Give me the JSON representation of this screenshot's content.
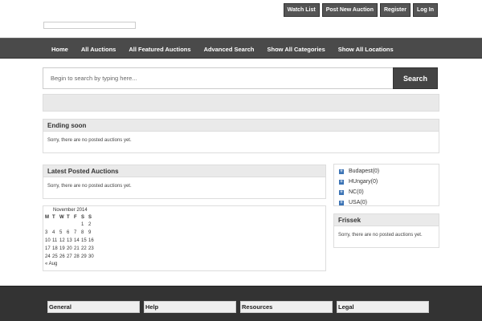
{
  "header": {
    "actions": [
      "Watch List",
      "Post New Auction",
      "Register",
      "Log In"
    ]
  },
  "nav": {
    "items": [
      "Home",
      "All Auctions",
      "All Featured Auctions",
      "Advanced Search",
      "Show All Categories",
      "Show All Locations"
    ]
  },
  "search": {
    "placeholder": "Begin to search by typing here...",
    "button_label": "Search"
  },
  "ending_soon": {
    "title": "Ending soon",
    "message": "Sorry, there are no posted auctions yet."
  },
  "latest": {
    "title": "Latest Posted Auctions",
    "message": "Sorry, there are no posted auctions yet."
  },
  "locations": {
    "items": [
      "Budapest(0)",
      "HUngary(0)",
      "NC(0)",
      "USA(0)"
    ]
  },
  "frissek": {
    "title": "Frissek",
    "message": "Sorry, there are no posted auctions yet."
  },
  "calendar": {
    "caption": "November 2014",
    "weekdays": [
      "M",
      "T",
      "W",
      "T",
      "F",
      "S",
      "S"
    ],
    "weeks": [
      [
        "",
        "",
        "",
        "",
        "",
        "1",
        "2"
      ],
      [
        "3",
        "4",
        "5",
        "6",
        "7",
        "8",
        "9"
      ],
      [
        "10",
        "11",
        "12",
        "13",
        "14",
        "15",
        "16"
      ],
      [
        "17",
        "18",
        "19",
        "20",
        "21",
        "22",
        "23"
      ],
      [
        "24",
        "25",
        "26",
        "27",
        "28",
        "29",
        "30"
      ]
    ],
    "prev_link": "« Aug"
  },
  "footer": {
    "columns": [
      "General",
      "Help",
      "Resources",
      "Legal"
    ]
  },
  "colors": {
    "nav_bg": "#4a4a4a",
    "button_bg": "#555555",
    "search_button_bg": "#444444",
    "location_icon": "#3b73b5",
    "footer_bg": "#333333"
  }
}
